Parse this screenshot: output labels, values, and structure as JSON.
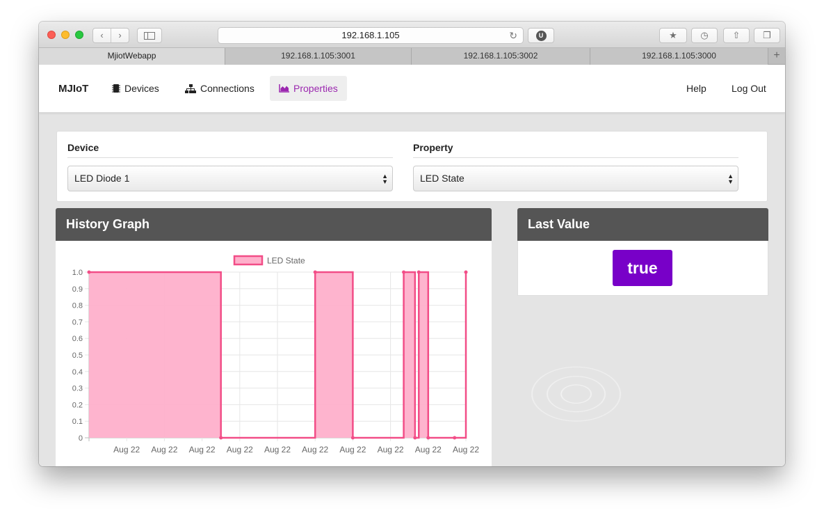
{
  "browser": {
    "address": "192.168.1.105",
    "tabs": [
      "MjiotWebapp",
      "192.168.1.105:3001",
      "192.168.1.105:3002",
      "192.168.1.105:3000"
    ]
  },
  "nav": {
    "brand": "MJIoT",
    "devices": "Devices",
    "connections": "Connections",
    "properties": "Properties",
    "help": "Help",
    "logout": "Log Out"
  },
  "selectors": {
    "device_label": "Device",
    "device_value": "LED Diode 1",
    "property_label": "Property",
    "property_value": "LED State"
  },
  "history": {
    "title": "History Graph"
  },
  "last_value": {
    "title": "Last Value",
    "value": "true"
  },
  "colors": {
    "accent": "#9b27af",
    "badge": "#7800c8",
    "series_line": "#f24d87",
    "series_fill": "#feb0cb",
    "panel_header": "#555555"
  },
  "chart_data": {
    "type": "area",
    "stepped": true,
    "legend": "top",
    "grid": true,
    "ylim": [
      0,
      1.0
    ],
    "yticks": [
      "1.0",
      "0.9",
      "0.8",
      "0.7",
      "0.6",
      "0.5",
      "0.4",
      "0.3",
      "0.2",
      "0.1",
      "0"
    ],
    "xticks": [
      "Aug 22",
      "Aug 22",
      "Aug 22",
      "Aug 22",
      "Aug 22",
      "Aug 22",
      "Aug 22",
      "Aug 22",
      "Aug 22",
      "Aug 22"
    ],
    "series": [
      {
        "name": "LED State",
        "points": [
          {
            "x": 0.0,
            "y": 1
          },
          {
            "x": 3.5,
            "y": 0
          },
          {
            "x": 6.0,
            "y": 1
          },
          {
            "x": 7.0,
            "y": 0
          },
          {
            "x": 8.35,
            "y": 1
          },
          {
            "x": 8.65,
            "y": 0
          },
          {
            "x": 8.75,
            "y": 1
          },
          {
            "x": 9.0,
            "y": 0
          },
          {
            "x": 9.7,
            "y": 0
          },
          {
            "x": 10.0,
            "y": 1
          }
        ]
      }
    ]
  }
}
